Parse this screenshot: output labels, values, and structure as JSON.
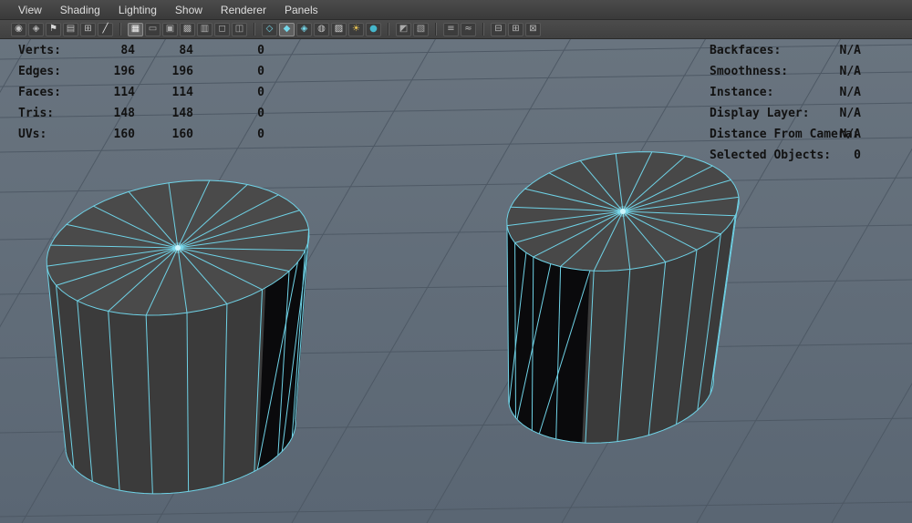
{
  "menu_bar": {
    "items": [
      {
        "label": "View"
      },
      {
        "label": "Shading"
      },
      {
        "label": "Lighting"
      },
      {
        "label": "Show"
      },
      {
        "label": "Renderer"
      },
      {
        "label": "Panels"
      }
    ]
  },
  "toolbar": {
    "groups": [
      [
        {
          "name": "camera-icon",
          "glyph": "◉",
          "color": "#c4c4c4"
        },
        {
          "name": "camera-attributes-icon",
          "glyph": "◈",
          "color": "#b8b8b8"
        },
        {
          "name": "bookmark-icon",
          "glyph": "⚑",
          "color": "#d8d8d8"
        },
        {
          "name": "image-plane-icon",
          "glyph": "▤",
          "color": "#bcbcbc"
        },
        {
          "name": "2d-pan-zoom-icon",
          "glyph": "⊞",
          "color": "#bcbcbc"
        },
        {
          "name": "grease-pencil-icon",
          "glyph": "╱",
          "color": "#e2e2e2"
        }
      ],
      [
        {
          "name": "grid-icon",
          "glyph": "▦",
          "color": "#f2f2f2",
          "active": true
        },
        {
          "name": "film-gate-icon",
          "glyph": "▭",
          "color": "#ababab"
        },
        {
          "name": "resolution-gate-icon",
          "glyph": "▣",
          "color": "#ababab"
        },
        {
          "name": "gate-mask-icon",
          "glyph": "▩",
          "color": "#ababab"
        },
        {
          "name": "field-chart-icon",
          "glyph": "▥",
          "color": "#ababab"
        },
        {
          "name": "safe-action-icon",
          "glyph": "◻",
          "color": "#ababab"
        },
        {
          "name": "safe-title-icon",
          "glyph": "◫",
          "color": "#ababab"
        }
      ],
      [
        {
          "name": "wireframe-icon",
          "glyph": "◇",
          "color": "#74d7ea"
        },
        {
          "name": "shaded-icon",
          "glyph": "◆",
          "color": "#74d7ea",
          "active": true
        },
        {
          "name": "textured-icon",
          "glyph": "◈",
          "color": "#74d7ea"
        },
        {
          "name": "use-default-material-icon",
          "glyph": "◍",
          "color": "#c0c0c0"
        },
        {
          "name": "checkered-icon",
          "glyph": "▨",
          "color": "#d8d8d8"
        },
        {
          "name": "lights-icon",
          "glyph": "☀",
          "color": "#e8c352"
        },
        {
          "name": "shadows-icon",
          "glyph": "●",
          "color": "#45b7cc"
        }
      ],
      [
        {
          "name": "isolate-select-icon",
          "glyph": "◩",
          "color": "#ababab"
        },
        {
          "name": "xray-icon",
          "glyph": "▧",
          "color": "#ababab"
        }
      ],
      [
        {
          "name": "exposure-icon",
          "glyph": "≡",
          "color": "#b4b4b4"
        },
        {
          "name": "gamma-icon",
          "glyph": "≈",
          "color": "#b4b4b4"
        }
      ],
      [
        {
          "name": "panel-single-icon",
          "glyph": "⊟",
          "color": "#b4b4b4"
        },
        {
          "name": "panel-four-icon",
          "glyph": "⊞",
          "color": "#b4b4b4"
        },
        {
          "name": "panel-outliner-icon",
          "glyph": "⊠",
          "color": "#b4b4b4"
        }
      ]
    ]
  },
  "hud": {
    "poly_count": {
      "rows": [
        {
          "label": "Verts:",
          "total": "84",
          "selected": "84",
          "extra": "0"
        },
        {
          "label": "Edges:",
          "total": "196",
          "selected": "196",
          "extra": "0"
        },
        {
          "label": "Faces:",
          "total": "114",
          "selected": "114",
          "extra": "0"
        },
        {
          "label": "Tris:",
          "total": "148",
          "selected": "148",
          "extra": "0"
        },
        {
          "label": "UVs:",
          "total": "160",
          "selected": "160",
          "extra": "0"
        }
      ]
    },
    "object_details": {
      "rows": [
        {
          "label": "Backfaces:",
          "value": "N/A"
        },
        {
          "label": "Smoothness:",
          "value": "N/A"
        },
        {
          "label": "Instance:",
          "value": "N/A"
        },
        {
          "label": "Display Layer:",
          "value": "N/A"
        },
        {
          "label": "Distance From Camera:",
          "value": "N/A"
        },
        {
          "label": "Selected Objects:",
          "value": "0"
        }
      ]
    }
  },
  "colors": {
    "viewport_bg": "#606c78",
    "grid_line": "#4d5864",
    "wireframe": "#6fd2e6",
    "wireframe_bright": "#cdf4fb",
    "menu_bg": "#3f3f3f",
    "toolbar_bg": "#454545",
    "hud_text": "#121212",
    "cap_fill": "#4a4a4a",
    "body_fill": "#3b3b3b",
    "hole_fill": "#0a0a0c"
  }
}
